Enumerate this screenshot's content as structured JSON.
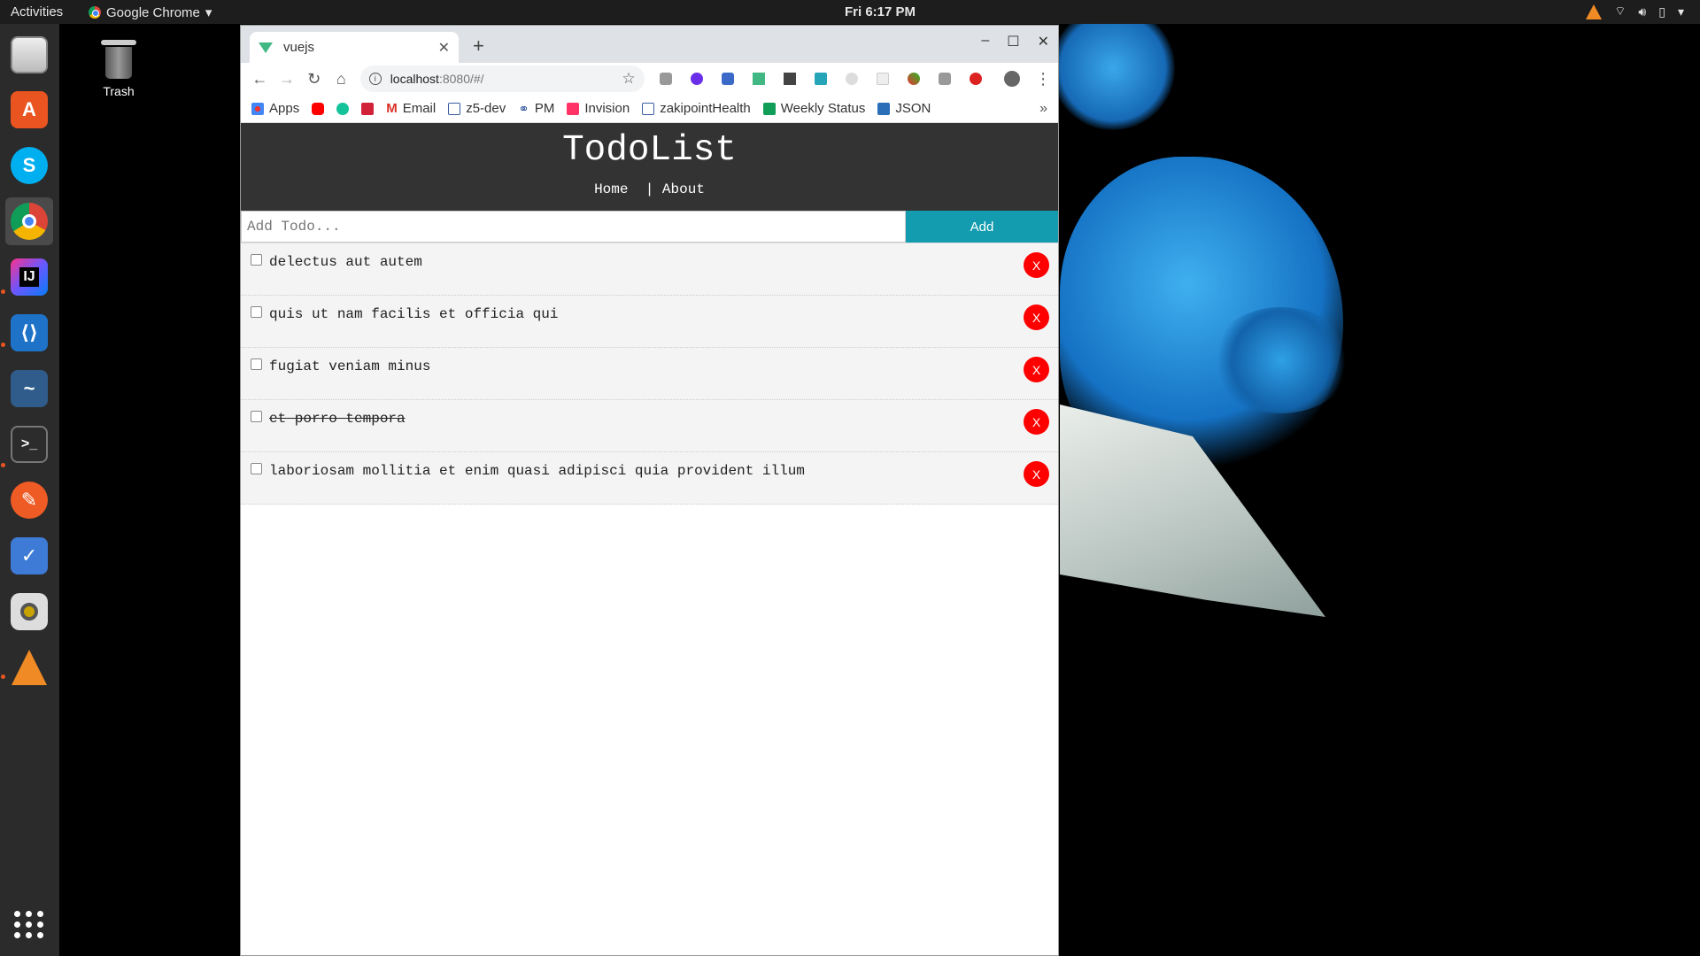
{
  "topbar": {
    "activities": "Activities",
    "app_menu": "Google Chrome",
    "clock": "Fri  6:17 PM"
  },
  "desktop": {
    "trash_label": "Trash"
  },
  "browser": {
    "tab_title": "vuejs",
    "url_host": "localhost",
    "url_path": ":8080/#/",
    "bookmarks": {
      "apps": "Apps",
      "email": "Email",
      "z5dev": "z5-dev",
      "pm": "PM",
      "invision": "Invision",
      "zakipoint": "zakipointHealth",
      "weekly": "Weekly Status",
      "json": "JSON",
      "more": "»"
    }
  },
  "app": {
    "title": "TodoList",
    "nav": {
      "home": "Home",
      "separator": "|",
      "about": "About"
    },
    "add_placeholder": "Add Todo...",
    "add_button": "Add",
    "delete_label": "X",
    "todos": [
      {
        "title": "delectus aut autem",
        "completed": false
      },
      {
        "title": "quis ut nam facilis et officia qui",
        "completed": false
      },
      {
        "title": "fugiat veniam minus",
        "completed": false
      },
      {
        "title": "et porro tempora",
        "completed": true
      },
      {
        "title": "laboriosam mollitia et enim quasi adipisci quia provident illum",
        "completed": false
      }
    ]
  },
  "colors": {
    "header_bg": "#333333",
    "add_button": "#139caf",
    "delete_button": "#ff0000",
    "todo_bg": "#f4f4f4"
  }
}
